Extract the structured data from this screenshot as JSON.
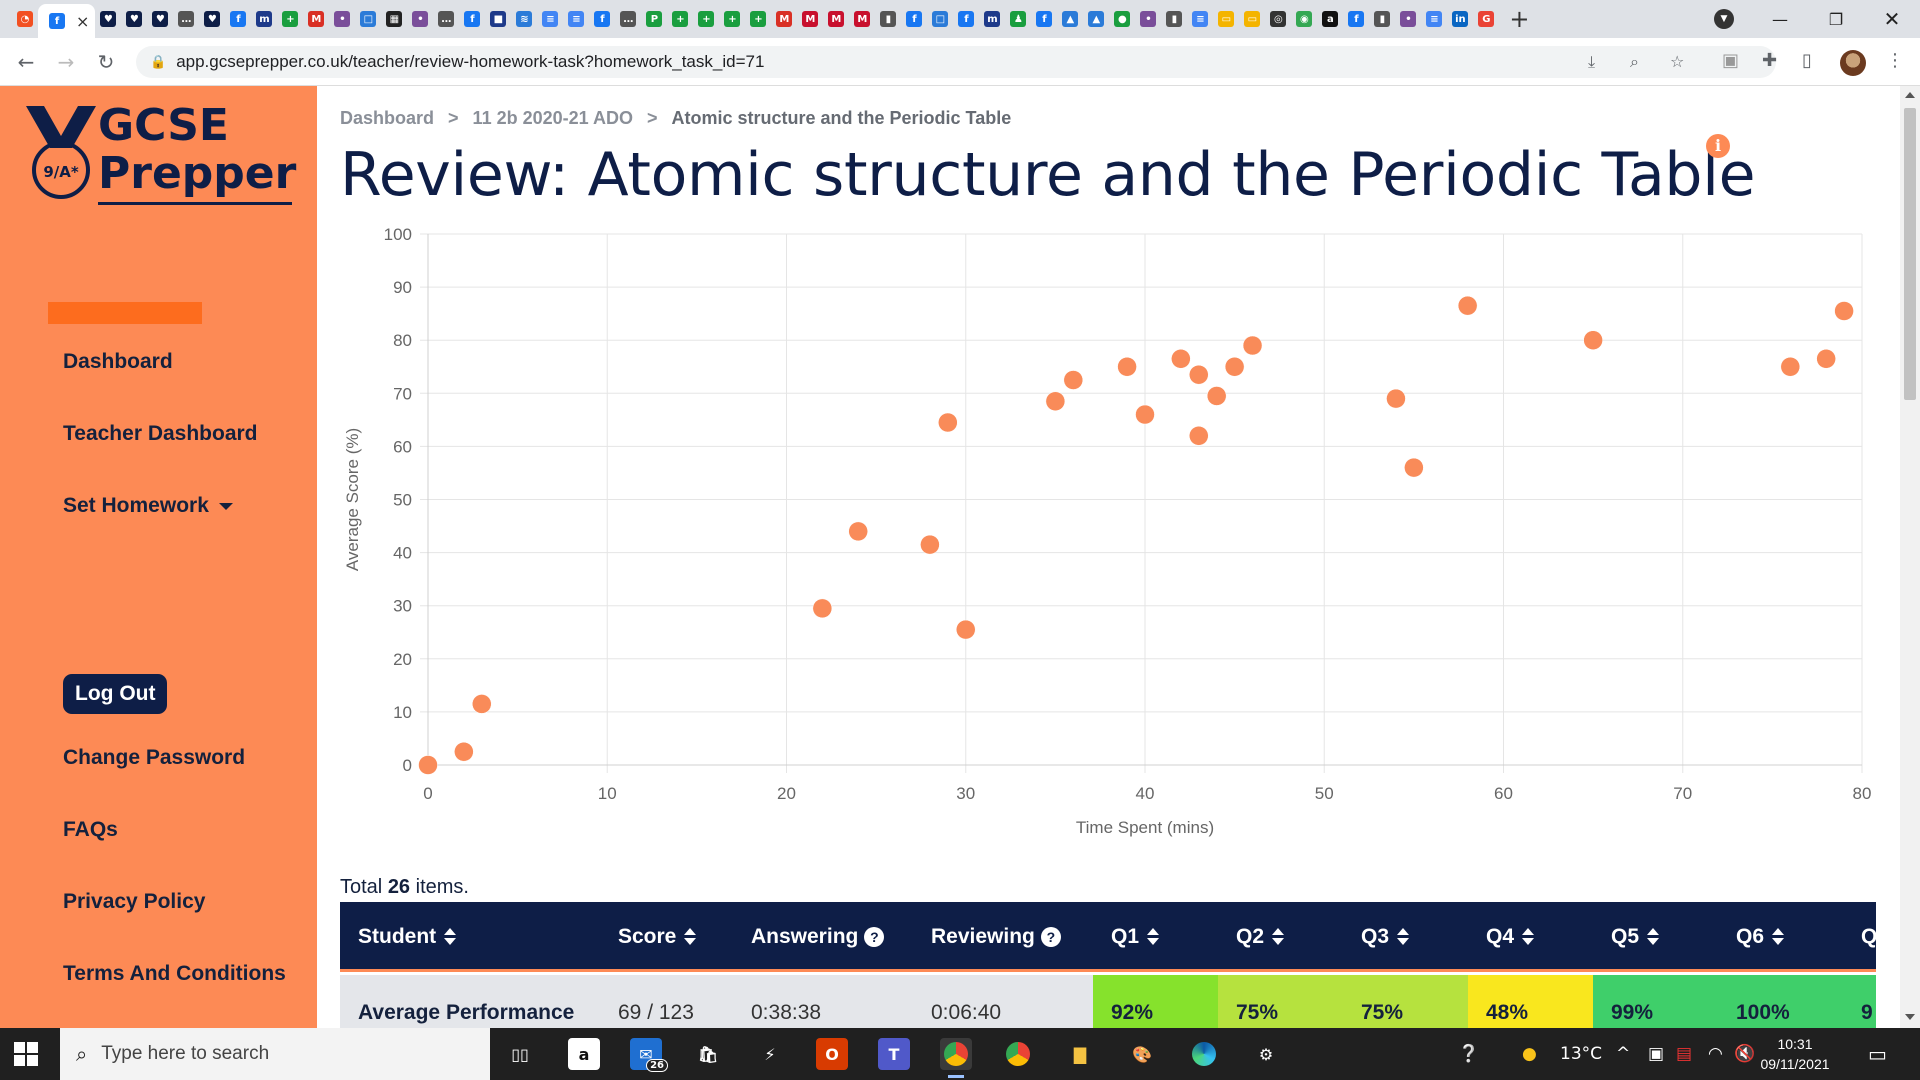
{
  "browser": {
    "tab_close": "×",
    "new_tab": "+",
    "url": "app.gcseprepper.co.uk/teacher/review-homework-task?homework_task_id=71",
    "favicons": [
      {
        "name": "microsoft-icon",
        "color": "#f25022",
        "glyph": "◔"
      },
      {
        "name": "facebook-icon",
        "color": "#1877f2",
        "glyph": "f"
      },
      {
        "name": "gcse-prepper-icon",
        "color": "#0e1e47",
        "glyph": "♥"
      },
      {
        "name": "gcse-prepper-icon",
        "color": "#0e1e47",
        "glyph": "♥"
      },
      {
        "name": "gcse-prepper-icon",
        "color": "#0e1e47",
        "glyph": "♥"
      },
      {
        "name": "more-icon",
        "color": "#555",
        "glyph": "…"
      },
      {
        "name": "gcse-prepper-icon",
        "color": "#0e1e47",
        "glyph": "♥"
      },
      {
        "name": "facebook-icon",
        "color": "#1877f2",
        "glyph": "f"
      },
      {
        "name": "m-icon",
        "color": "#1e3a8a",
        "glyph": "m"
      },
      {
        "name": "plus-icon",
        "color": "#1a9e3f",
        "glyph": "+"
      },
      {
        "name": "gmail-icon",
        "color": "#d93025",
        "glyph": "M"
      },
      {
        "name": "app-icon",
        "color": "#7a4e9a",
        "glyph": "•"
      },
      {
        "name": "app-icon",
        "color": "#2b7bd8",
        "glyph": "□"
      },
      {
        "name": "app-icon",
        "color": "#222",
        "glyph": "▦"
      },
      {
        "name": "app-icon",
        "color": "#7a4e9a",
        "glyph": "•"
      },
      {
        "name": "more-icon",
        "color": "#555",
        "glyph": "…"
      },
      {
        "name": "facebook-icon",
        "color": "#1877f2",
        "glyph": "f"
      },
      {
        "name": "app-icon",
        "color": "#1e3a8a",
        "glyph": "■"
      },
      {
        "name": "audio-icon",
        "color": "#2b7bd8",
        "glyph": "≋"
      },
      {
        "name": "docs-icon",
        "color": "#4285f4",
        "glyph": "≡"
      },
      {
        "name": "docs-icon",
        "color": "#4285f4",
        "glyph": "≡"
      },
      {
        "name": "facebook-icon",
        "color": "#1877f2",
        "glyph": "f"
      },
      {
        "name": "more-icon",
        "color": "#555",
        "glyph": "…"
      },
      {
        "name": "app-icon",
        "color": "#1a9e3f",
        "glyph": "P"
      },
      {
        "name": "plus-icon",
        "color": "#1a9e3f",
        "glyph": "+"
      },
      {
        "name": "plus-icon",
        "color": "#1a9e3f",
        "glyph": "+"
      },
      {
        "name": "plus-icon",
        "color": "#1a9e3f",
        "glyph": "+"
      },
      {
        "name": "plus-icon",
        "color": "#1a9e3f",
        "glyph": "+"
      },
      {
        "name": "gmail-icon",
        "color": "#d93025",
        "glyph": "M"
      },
      {
        "name": "app-icon",
        "color": "#c8102e",
        "glyph": "M"
      },
      {
        "name": "app-icon",
        "color": "#c8102e",
        "glyph": "M"
      },
      {
        "name": "app-icon",
        "color": "#c8102e",
        "glyph": "M"
      },
      {
        "name": "analytics-icon",
        "color": "#555",
        "glyph": "▮"
      },
      {
        "name": "facebook-icon",
        "color": "#1877f2",
        "glyph": "f"
      },
      {
        "name": "app-icon",
        "color": "#2b7bd8",
        "glyph": "□"
      },
      {
        "name": "facebook-icon",
        "color": "#1877f2",
        "glyph": "f"
      },
      {
        "name": "m-icon",
        "color": "#1e3a8a",
        "glyph": "m"
      },
      {
        "name": "app-icon",
        "color": "#1a9e3f",
        "glyph": "♟"
      },
      {
        "name": "facebook-icon",
        "color": "#1877f2",
        "glyph": "f"
      },
      {
        "name": "app-icon",
        "color": "#2b7bd8",
        "glyph": "▲"
      },
      {
        "name": "app-icon",
        "color": "#2b7bd8",
        "glyph": "▲"
      },
      {
        "name": "app-icon",
        "color": "#1a9e3f",
        "glyph": "●"
      },
      {
        "name": "app-icon",
        "color": "#7a4e9a",
        "glyph": "•"
      },
      {
        "name": "analytics-icon",
        "color": "#555",
        "glyph": "▮"
      },
      {
        "name": "docs-icon",
        "color": "#4285f4",
        "glyph": "≡"
      },
      {
        "name": "slides-icon",
        "color": "#f4b400",
        "glyph": "▭"
      },
      {
        "name": "slides-icon",
        "color": "#f4b400",
        "glyph": "▭"
      },
      {
        "name": "app-icon",
        "color": "#333",
        "glyph": "◎"
      },
      {
        "name": "maps-icon",
        "color": "#34a853",
        "glyph": "◉"
      },
      {
        "name": "abc-icon",
        "color": "#111",
        "glyph": "a"
      },
      {
        "name": "facebook-icon",
        "color": "#1877f2",
        "glyph": "f"
      },
      {
        "name": "analytics-icon",
        "color": "#555",
        "glyph": "▮"
      },
      {
        "name": "app-icon",
        "color": "#7a4e9a",
        "glyph": "•"
      },
      {
        "name": "docs-icon",
        "color": "#4285f4",
        "glyph": "≡"
      },
      {
        "name": "linkedin-icon",
        "color": "#0a66c2",
        "glyph": "in"
      },
      {
        "name": "google-icon",
        "color": "#ea4335",
        "glyph": "G"
      }
    ]
  },
  "sidebar": {
    "logo_text": [
      "GCSE",
      "Prepper"
    ],
    "logo_badge": "9/A*",
    "items": [
      {
        "label": "Dashboard"
      },
      {
        "label": "Teacher Dashboard"
      },
      {
        "label": "Set Homework"
      },
      {
        "label": "Change Password"
      },
      {
        "label": "FAQs"
      },
      {
        "label": "Privacy Policy"
      },
      {
        "label": "Terms And Conditions"
      }
    ],
    "logout_label": "Log Out"
  },
  "breadcrumb": {
    "items": [
      "Dashboard",
      "11 2b 2020-21 ADO",
      "Atomic structure and the Periodic Table"
    ],
    "separator": ">"
  },
  "page": {
    "title": "Review: Atomic structure and the Periodic Table"
  },
  "chart_data": {
    "type": "scatter",
    "xlabel": "Time Spent (mins)",
    "ylabel": "Average Score (%)",
    "xlim": [
      0,
      80
    ],
    "ylim": [
      0,
      100
    ],
    "xticks": [
      0,
      10,
      20,
      30,
      40,
      50,
      60,
      70,
      80
    ],
    "yticks": [
      0,
      10,
      20,
      30,
      40,
      50,
      60,
      70,
      80,
      90,
      100
    ],
    "grid": true,
    "point_color": "#f98b59",
    "points": [
      [
        0,
        0
      ],
      [
        2,
        2.5
      ],
      [
        3,
        11.5
      ],
      [
        22,
        29.5
      ],
      [
        24,
        44
      ],
      [
        28,
        41.5
      ],
      [
        29,
        64.5
      ],
      [
        30,
        25.5
      ],
      [
        35,
        68.5
      ],
      [
        36,
        72.5
      ],
      [
        39,
        75
      ],
      [
        40,
        66
      ],
      [
        42,
        76.5
      ],
      [
        43,
        73.5
      ],
      [
        43,
        62
      ],
      [
        44,
        69.5
      ],
      [
        45,
        75
      ],
      [
        46,
        79
      ],
      [
        54,
        69
      ],
      [
        55,
        56
      ],
      [
        58,
        86.5
      ],
      [
        65,
        80
      ],
      [
        76,
        75
      ],
      [
        78,
        76.5
      ],
      [
        79,
        85.5
      ]
    ]
  },
  "summary": {
    "prefix": "Total",
    "count": "26",
    "suffix": "items."
  },
  "table": {
    "headers": [
      "Student",
      "Score",
      "Answering",
      "Reviewing",
      "Q1",
      "Q2",
      "Q3",
      "Q4",
      "Q5",
      "Q6",
      "Q"
    ],
    "avg_row": {
      "label": "Average Performance",
      "score": "69 / 123",
      "answering": "0:38:38",
      "reviewing": "0:06:40",
      "questions": [
        {
          "value": "92%",
          "color": "#86e22c"
        },
        {
          "value": "75%",
          "color": "#b6e23e"
        },
        {
          "value": "75%",
          "color": "#b6e23e"
        },
        {
          "value": "48%",
          "color": "#f9e71e"
        },
        {
          "value": "99%",
          "color": "#3fcf6a"
        },
        {
          "value": "100%",
          "color": "#3fcf6a"
        },
        {
          "value": "9",
          "color": "#3fcf6a"
        }
      ]
    }
  },
  "taskbar": {
    "search_placeholder": "Type here to search",
    "mail_badge": "26",
    "temperature": "13°C",
    "time": "10:31",
    "date": "09/11/2021"
  }
}
